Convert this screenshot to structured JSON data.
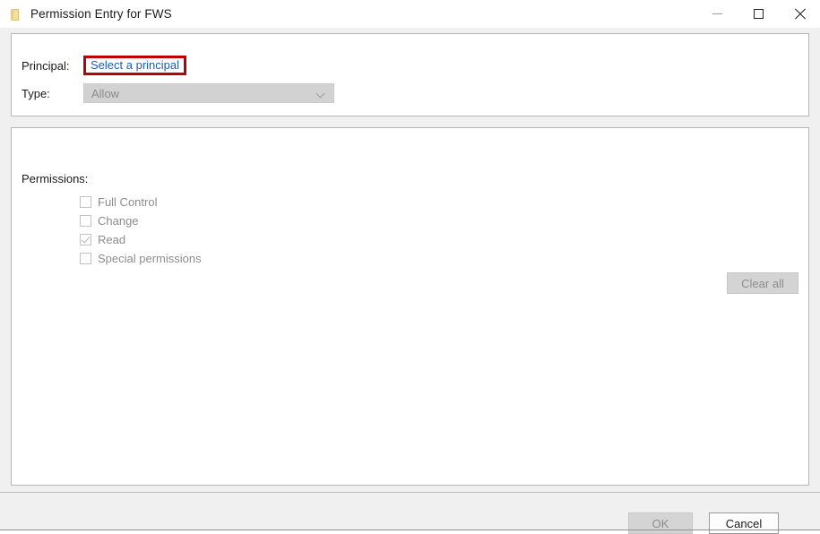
{
  "window": {
    "title": "Permission Entry for FWS",
    "icon": "folder-icon",
    "controls": {
      "minimize": "minimize-icon",
      "maximize": "maximize-icon",
      "close": "close-icon"
    }
  },
  "colors": {
    "link": "#1f5fa9",
    "highlight_border": "#c00000",
    "panel_background": "#ffffff",
    "dialog_background": "#f0f0f0",
    "disabled_text": "#8d8d8d"
  },
  "top_panel": {
    "principal": {
      "label": "Principal:",
      "link_text": "Select a principal",
      "highlighted": true
    },
    "type": {
      "label": "Type:",
      "selected_value": "Allow",
      "disabled": true,
      "options": [
        "Allow"
      ]
    }
  },
  "permissions_panel": {
    "label": "Permissions:",
    "items": [
      {
        "label": "Full Control",
        "checked": false,
        "disabled": true
      },
      {
        "label": "Change",
        "checked": false,
        "disabled": true
      },
      {
        "label": "Read",
        "checked": true,
        "disabled": true
      },
      {
        "label": "Special permissions",
        "checked": false,
        "disabled": true
      }
    ],
    "clear_all_label": "Clear all",
    "clear_all_disabled": true
  },
  "footer": {
    "ok_label": "OK",
    "ok_disabled": true,
    "cancel_label": "Cancel",
    "cancel_disabled": false
  }
}
